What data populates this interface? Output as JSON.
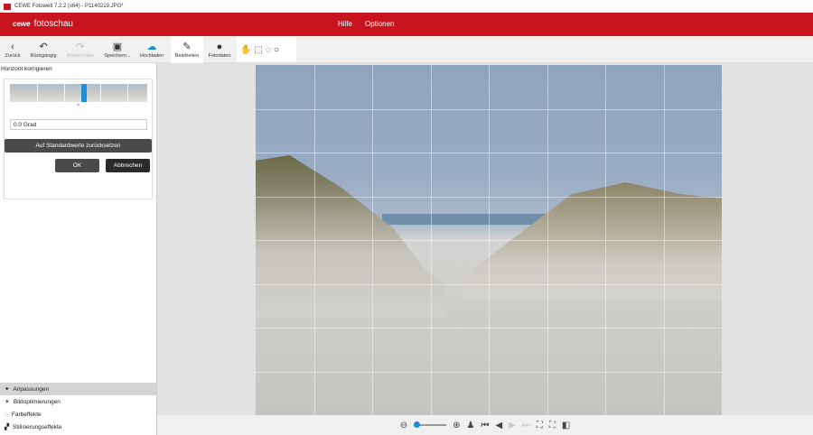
{
  "window": {
    "title": "CEWE Fotowelt 7.2.2 (x64) - P1140219.JPG*"
  },
  "header": {
    "logo_brand": "cewe",
    "logo_text": "fotoschau",
    "menu": [
      "Hilfe",
      "Optionen"
    ]
  },
  "toolbar": {
    "items": [
      {
        "label": "Zurück",
        "icon": "‹"
      },
      {
        "label": "Rückgängig",
        "icon": "↶"
      },
      {
        "label": "Wiederholen",
        "icon": "↷"
      },
      {
        "label": "Speichern...",
        "icon": "▣"
      },
      {
        "label": "Hochladen",
        "icon": "☁"
      },
      {
        "label": "Bearbeiten",
        "icon": "✎"
      },
      {
        "label": "Fotodaten",
        "icon": "●"
      }
    ]
  },
  "panel": {
    "title": "Horizont korrigieren",
    "angle": "0.0 Grad",
    "reset": "Auf Standardwerte zurücksetzen",
    "ok": "OK",
    "cancel": "Abbrechen"
  },
  "categories": [
    "Anpassungen",
    "Bildoptimierungen",
    "Farbeffekte",
    "Stilisierungseffekte"
  ],
  "colors": {
    "brand": "#c8141e",
    "accent": "#1a8fd6"
  }
}
